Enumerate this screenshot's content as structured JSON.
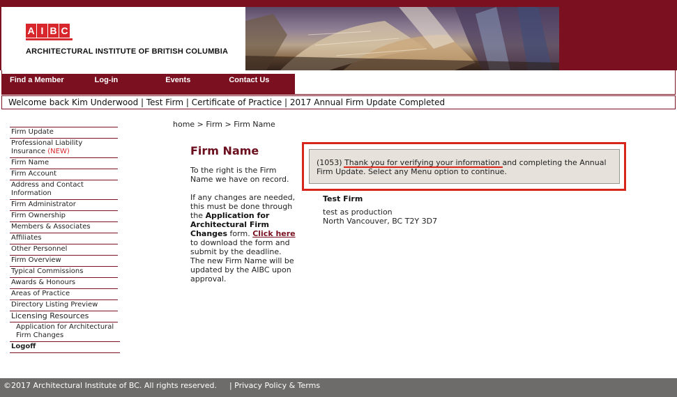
{
  "header": {
    "logo_letters": [
      "A",
      "I",
      "B",
      "C"
    ],
    "logo_text": "ARCHITECTURAL INSTITUTE OF BRITISH COLUMBIA",
    "brand_color": "#7b1020",
    "logo_red": "#d7262c"
  },
  "nav": {
    "items": [
      {
        "label": "Find a Member"
      },
      {
        "label": "Log-in"
      },
      {
        "label": "Events"
      },
      {
        "label": "Contact Us"
      }
    ]
  },
  "welcome": {
    "text": "Welcome back Kim Underwood | Test Firm | Certificate of Practice | 2017 Annual Firm Update Completed"
  },
  "sidebar": {
    "items": [
      {
        "label": "Firm Update"
      },
      {
        "label": "Professional Liability Insurance",
        "badge": "(NEW)"
      },
      {
        "label": "Firm Name"
      },
      {
        "label": "Firm Account"
      },
      {
        "label": "Address and Contact Information"
      },
      {
        "label": "Firm Administrator"
      },
      {
        "label": "Firm Ownership"
      },
      {
        "label": "Members & Associates"
      },
      {
        "label": "Affiliates"
      },
      {
        "label": "Other Personnel"
      },
      {
        "label": "Firm Overview"
      },
      {
        "label": "Typical Commissions"
      },
      {
        "label": "Awards & Honours"
      },
      {
        "label": "Areas of Practice"
      },
      {
        "label": "Directory Listing Preview"
      }
    ],
    "licensing_label": "Licensing Resources",
    "sub_item": "Application for Architectural Firm Changes",
    "logoff_label": "Logoff"
  },
  "breadcrumb": "home > Firm > Firm Name",
  "main": {
    "title": "Firm Name",
    "para1": "To the right is the Firm Name we have on record.",
    "para2_pre": "If any changes are needed, this must be done through the ",
    "para2_bold": "Application for Architectural Firm Changes",
    "para2_mid": " form. ",
    "para2_link": "Click here",
    "para2_post": " to download the form and submit by the deadline. The new Firm Name will be updated by the AIBC upon approval."
  },
  "message": {
    "code": "(1053) ",
    "highlight": "Thank you for verifying your information",
    "rest": " and completing the Annual Firm Update. Select any Menu option to continue.",
    "outline_color": "#d9261c"
  },
  "firm": {
    "name": "Test Firm",
    "line1": "test as production",
    "line2": "North Vancouver, BC T2Y 3D7"
  },
  "footer": {
    "copyright": "©2017 Architectural Institute of BC. All rights reserved.",
    "privacy": "| Privacy Policy & Terms"
  }
}
